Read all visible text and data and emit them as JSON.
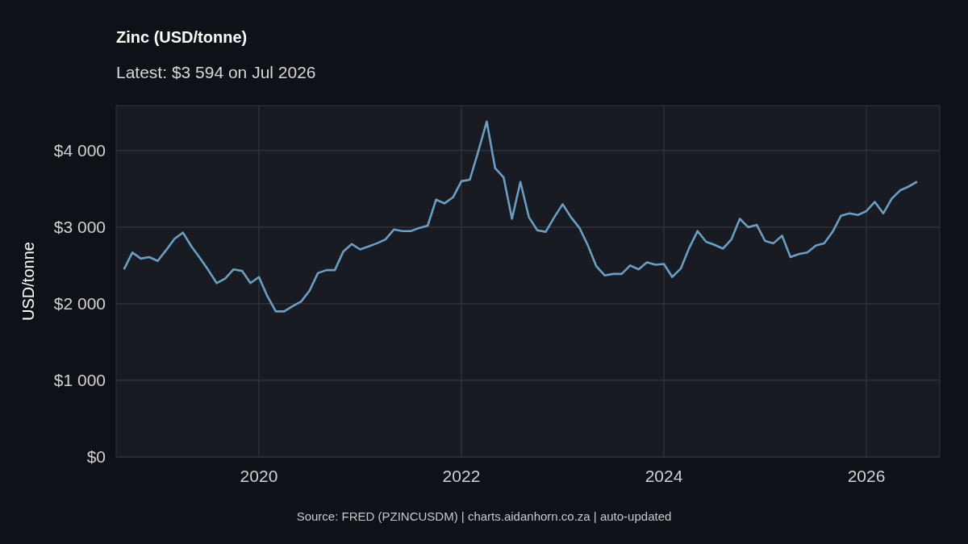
{
  "title": "Zinc (USD/tonne)",
  "subtitle": "Latest: $3 594 on Jul 2026",
  "chart": {
    "chart_data": {
      "type": "line",
      "ylabel": "USD/tonne",
      "x": [
        2018.667,
        2018.75,
        2018.833,
        2018.917,
        2019,
        2019.083,
        2019.167,
        2019.25,
        2019.333,
        2019.417,
        2019.5,
        2019.583,
        2019.667,
        2019.75,
        2019.833,
        2019.917,
        2020,
        2020.083,
        2020.167,
        2020.25,
        2020.333,
        2020.417,
        2020.5,
        2020.583,
        2020.667,
        2020.75,
        2020.833,
        2020.917,
        2021,
        2021.083,
        2021.167,
        2021.25,
        2021.333,
        2021.417,
        2021.5,
        2021.583,
        2021.667,
        2021.75,
        2021.833,
        2021.917,
        2022,
        2022.083,
        2022.167,
        2022.25,
        2022.333,
        2022.417,
        2022.5,
        2022.583,
        2022.667,
        2022.75,
        2022.833,
        2022.917,
        2023,
        2023.083,
        2023.167,
        2023.25,
        2023.333,
        2023.417,
        2023.5,
        2023.583,
        2023.667,
        2023.75,
        2023.833,
        2023.917,
        2024,
        2024.083,
        2024.167,
        2024.25,
        2024.333,
        2024.417,
        2024.5,
        2024.583,
        2024.667,
        2024.75,
        2024.833,
        2024.917,
        2025,
        2025.083,
        2025.167,
        2025.25,
        2025.333,
        2025.417,
        2025.5,
        2025.583,
        2025.667,
        2025.75,
        2025.833,
        2025.917,
        2026,
        2026.083,
        2026.167,
        2026.25,
        2026.333,
        2026.417,
        2026.5
      ],
      "series": [
        {
          "color": "#6a9ec4",
          "values": [
            2450,
            2670,
            2590,
            2610,
            2560,
            2700,
            2850,
            2930,
            2750,
            2600,
            2440,
            2270,
            2330,
            2450,
            2430,
            2270,
            2350,
            2100,
            1900,
            1900,
            1970,
            2030,
            2170,
            2400,
            2440,
            2440,
            2680,
            2780,
            2710,
            2750,
            2790,
            2840,
            2970,
            2950,
            2950,
            2990,
            3020,
            3360,
            3310,
            3390,
            3600,
            3620,
            3990,
            4380,
            3770,
            3650,
            3110,
            3590,
            3130,
            2960,
            2940,
            3130,
            3300,
            3130,
            2990,
            2760,
            2490,
            2370,
            2390,
            2390,
            2500,
            2450,
            2540,
            2510,
            2520,
            2350,
            2460,
            2730,
            2950,
            2810,
            2770,
            2720,
            2840,
            3110,
            3000,
            3030,
            2820,
            2790,
            2890,
            2610,
            2650,
            2670,
            2760,
            2790,
            2940,
            3150,
            3180,
            3160,
            3210,
            3330,
            3180,
            3370,
            3480,
            3530,
            3594
          ]
        }
      ],
      "grid": true,
      "xlim": [
        2018.59,
        2026.725
      ],
      "ylim": [
        0,
        4588
      ],
      "xticks": [
        2020,
        2022,
        2024,
        2026
      ],
      "yticks": [
        {
          "value": 0,
          "label": "$0"
        },
        {
          "value": 1000,
          "label": "$1 000"
        },
        {
          "value": 2000,
          "label": "$2 000"
        },
        {
          "value": 3000,
          "label": "$3 000"
        },
        {
          "value": 4000,
          "label": "$4 000"
        }
      ]
    }
  },
  "caption": "Source: FRED (PZINCUSDM) | charts.aidanhorn.co.za | auto-updated"
}
